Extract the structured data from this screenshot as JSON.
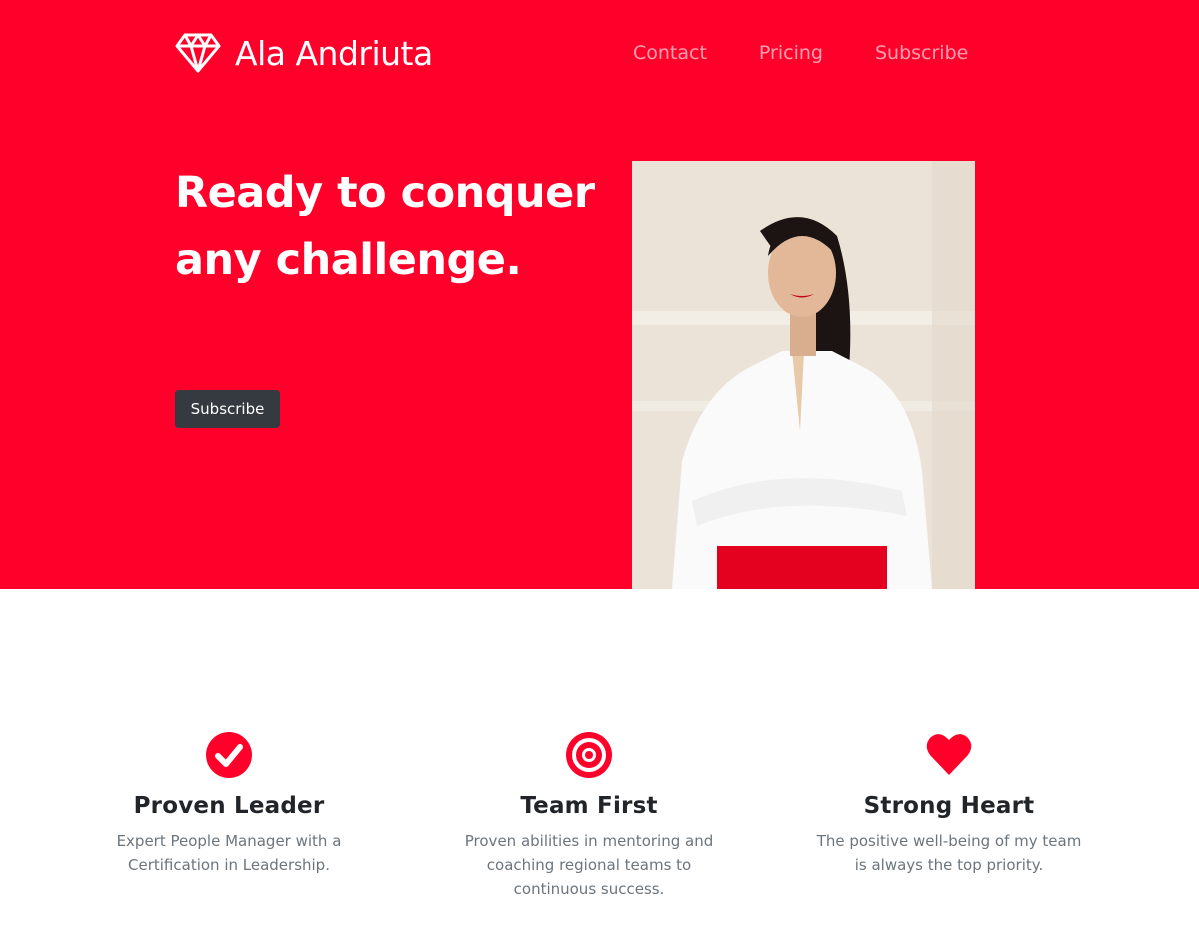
{
  "brand": {
    "name": "Ala Andriuta",
    "icon": "diamond-icon"
  },
  "nav": {
    "items": [
      "Contact",
      "Pricing",
      "Subscribe"
    ]
  },
  "hero": {
    "headline": "Ready to conquer any challenge.",
    "button_label": "Subscribe",
    "image": "portrait-photo"
  },
  "features": [
    {
      "icon": "check-circle-icon",
      "title": "Proven Leader",
      "text": "Expert People Manager with a Certification in Leadership."
    },
    {
      "icon": "target-icon",
      "title": "Team First",
      "text": "Proven abilities in mentoring and coaching regional teams to continuous success."
    },
    {
      "icon": "heart-icon",
      "title": "Strong Heart",
      "text": "The positive well-being of my team is always the top priority."
    }
  ],
  "colors": {
    "accent": "#ff002b",
    "button_dark": "#343a40",
    "heading": "#212529",
    "muted": "#6c757d"
  }
}
